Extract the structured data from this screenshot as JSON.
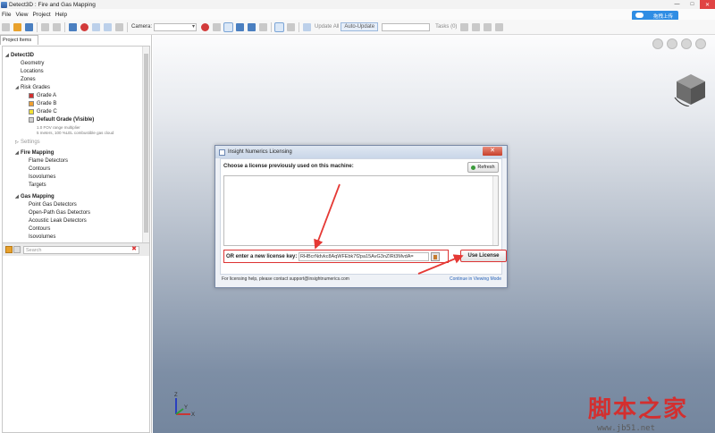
{
  "window": {
    "title": "Detect3D : Fire and Gas Mapping",
    "minimize": "—",
    "maximize": "□",
    "close": "✕"
  },
  "menu": [
    "File",
    "View",
    "Project",
    "Help"
  ],
  "upload_button": "拖拽上传",
  "toolbar": {
    "camera_label": "Camera:",
    "update_all": "Update All",
    "auto_update": "Auto-Update",
    "tasks": "Tasks (0)"
  },
  "left_panel": {
    "tab": "Project Items",
    "tree": {
      "root": "Detect3D",
      "items": [
        "Geometry",
        "Locations",
        "Zones"
      ],
      "risk_grades": "Risk Grades",
      "grades": [
        {
          "label": "Grade A",
          "color": "#d32f2f"
        },
        {
          "label": "Grade B",
          "color": "#f0a030"
        },
        {
          "label": "Grade C",
          "color": "#f2e233"
        },
        {
          "label": "Default Grade (Visible)",
          "color": "#d0d0d0"
        }
      ],
      "default_note_1": "1.0 FOV range multiplier",
      "default_note_2": "5 meters, 100 %LEL combustible gas cloud",
      "settings": "Settings",
      "fire_mapping": "Fire Mapping",
      "fire_items": [
        "Flame Detectors",
        "Contours",
        "Isovolumes",
        "Targets"
      ],
      "gas_mapping": "Gas Mapping",
      "gas_items": [
        "Point Gas Detectors",
        "Open-Path Gas Detectors",
        "Acoustic Leak Detectors",
        "Contours",
        "Isovolumes"
      ]
    },
    "search_placeholder": "Search",
    "search_clear": "✖"
  },
  "dialog": {
    "title": "Insight Numerics Licensing",
    "close": "✕",
    "prev_label": "Choose a license previously used on this machine:",
    "refresh": "Refresh",
    "new_key_label": "OR enter a new license key:",
    "key_value": "RHBcrNdvkc8AqWFEbk7f2pa15AvG3nZIRt3MvdA=",
    "use_license": "Use License",
    "footer": "For licensing help, please contact support@insightnumerics.com",
    "continue_link": "Continue in Viewing Mode"
  },
  "viewport": {
    "axis_labels": [
      "Z",
      "Y",
      "X"
    ],
    "cube_face": "View cube"
  },
  "watermark": {
    "title": "脚本之家",
    "url": "www.jb51.net"
  }
}
